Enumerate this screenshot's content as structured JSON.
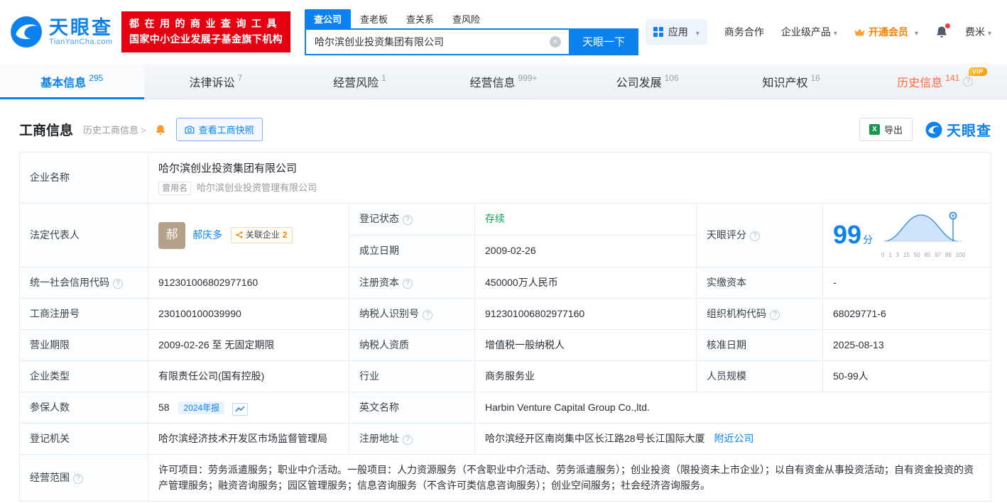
{
  "colors": {
    "primary_blue": "#0b82f0",
    "banner_red": "#e60012",
    "vip_orange": "#ff8000",
    "history_tab_orange": "#ff6a3b",
    "status_green": "#00a854"
  },
  "header": {
    "logo": {
      "brand": "天眼查",
      "domain": "TianYanCha.com"
    },
    "slogan": {
      "line1": "都在用的商业查询工具",
      "line2": "国家中小企业发展子基金旗下机构"
    },
    "search": {
      "tabs": [
        {
          "label": "查公司"
        },
        {
          "label": "查老板"
        },
        {
          "label": "查关系"
        },
        {
          "label": "查风险"
        }
      ],
      "value": "哈尔滨创业投资集团有限公司",
      "button": "天眼一下"
    },
    "nav": {
      "apps": "应用",
      "cooperation": "商务合作",
      "enterprise": "企业级产品",
      "vip": "开通会员",
      "user": "费米"
    }
  },
  "tabs": [
    {
      "label": "基本信息",
      "count": "295"
    },
    {
      "label": "法律诉讼",
      "count": "7"
    },
    {
      "label": "经营风险",
      "count": "1"
    },
    {
      "label": "经营信息",
      "count": "999+"
    },
    {
      "label": "公司发展",
      "count": "106"
    },
    {
      "label": "知识产权",
      "count": "16"
    },
    {
      "label": "历史信息",
      "count": "141",
      "vip_badge": "VIP"
    }
  ],
  "toolbar": {
    "title": "工商信息",
    "history_link": "历史工商信息",
    "snapshot_button": "查看工商快照",
    "export_button": "导出",
    "watermark_brand": "天眼查"
  },
  "info": {
    "name_label": "企业名称",
    "name": "哈尔滨创业投资集团有限公司",
    "former_tag": "曾用名",
    "former_name": "哈尔滨创业投资管理有限公司",
    "legal_label": "法定代表人",
    "legal_avatar": "郝",
    "legal_name": "郝庆多",
    "related_label": "关联企业",
    "related_count": "2",
    "status_label": "登记状态",
    "status": "存续",
    "founded_label": "成立日期",
    "founded": "2009-02-26",
    "score_label": "天眼评分",
    "score": "99",
    "score_unit": "分",
    "score_axis": [
      "0",
      "1",
      "3",
      "15",
      "50",
      "85",
      "97",
      "99",
      "100"
    ],
    "credit_label": "统一社会信用代码",
    "credit": "912301006802977160",
    "capital_label": "注册资本",
    "capital": "450000万人民币",
    "paid_label": "实缴资本",
    "paid": "-",
    "regno_label": "工商注册号",
    "regno": "230100100039990",
    "tax_label": "纳税人识别号",
    "tax": "912301006802977160",
    "org_label": "组织机构代码",
    "org": "68029771-6",
    "term_label": "营业期限",
    "term": "2009-02-26 至 无固定期限",
    "taxq_label": "纳税人资质",
    "taxq": "增值税一般纳税人",
    "approve_label": "核准日期",
    "approve": "2025-08-13",
    "type_label": "企业类型",
    "type": "有限责任公司(国有控股)",
    "industry_label": "行业",
    "industry": "商务服务业",
    "staff_label": "人员规模",
    "staff": "50-99人",
    "insured_label": "参保人数",
    "insured": "58",
    "insured_tag": "2024年报",
    "en_label": "英文名称",
    "en_name": "Harbin Venture Capital Group Co.,ltd.",
    "authority_label": "登记机关",
    "authority": "哈尔滨经济技术开发区市场监督管理局",
    "addr_label": "注册地址",
    "addr": "哈尔滨经开区南岗集中区长江路28号长江国际大厦",
    "nearby": "附近公司",
    "scope_label": "经营范围",
    "scope": "许可项目：劳务派遣服务；职业中介活动。一般项目：人力资源服务（不含职业中介活动、劳务派遣服务）；创业投资（限投资未上市企业）；以自有资金从事投资活动；自有资金投资的资产管理服务；融资咨询服务；园区管理服务；信息咨询服务（不含许可类信息咨询服务）；创业空间服务；社会经济咨询服务。"
  }
}
